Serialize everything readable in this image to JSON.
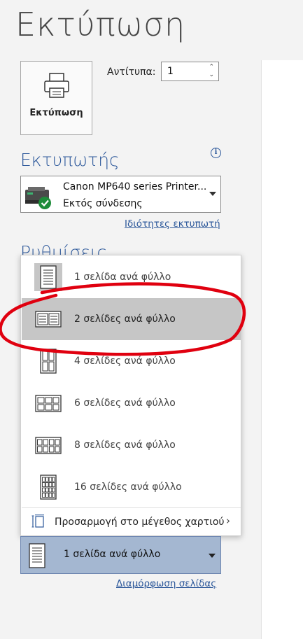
{
  "page": {
    "title": "Εκτύπωση"
  },
  "print_button": {
    "label": "Εκτύπωση",
    "icon": "printer-icon"
  },
  "copies": {
    "label": "Αντίτυπα:",
    "value": "1"
  },
  "printer": {
    "heading": "Εκτυπωτής",
    "name": "Canon MP640 series Printer...",
    "status": "Εκτός σύνδεσης",
    "properties_link": "Ιδιότητες εκτυπωτή",
    "status_color": "#1e8c3a"
  },
  "settings": {
    "heading": "Ρυθμίσεις"
  },
  "pages_per_sheet_menu": {
    "items": [
      {
        "label": "1 σελίδα ανά φύλλο"
      },
      {
        "label": "2 σελίδες ανά φύλλο"
      },
      {
        "label": "4 σελίδες ανά φύλλο"
      },
      {
        "label": "6 σελίδες ανά φύλλο"
      },
      {
        "label": "8 σελίδες ανά φύλλο"
      },
      {
        "label": "16 σελίδες ανά φύλλο"
      }
    ],
    "highlighted_item": "2 σελίδες ανά φύλλο",
    "fit_to_paper": "Προσαρμογή στο μέγεθος χαρτιού"
  },
  "pages_per_sheet_select": {
    "value": "1 σελίδα ανά φύλλο"
  },
  "page_setup_link": "Διαμόρφωση σελίδας",
  "colors": {
    "accent": "#2b579a",
    "highlight": "#c6c6c6",
    "selected": "#a4b7d1",
    "annotation": "#e0000f"
  }
}
